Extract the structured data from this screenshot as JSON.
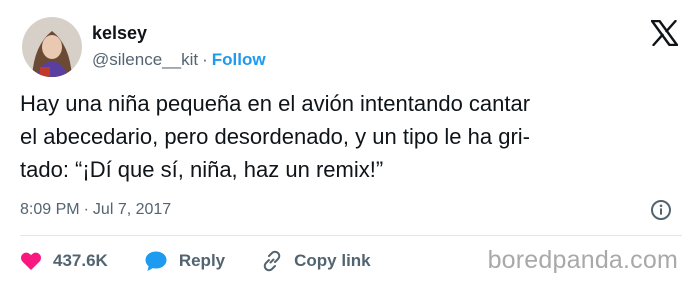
{
  "author": {
    "display_name": "kelsey",
    "handle": "@silence__kit",
    "separator": "·",
    "follow_label": "Follow"
  },
  "tweet": {
    "lines": [
      "Hay una niña pequeña en el avión intentando cantar",
      "el abecedario, pero desordenado, y un tipo le ha gri-",
      "tado: “¡Dí que sí, niña, haz un remix!”"
    ],
    "time": "8:09 PM",
    "separator": "·",
    "date": "Jul 7, 2017"
  },
  "actions": {
    "likes": "437.6K",
    "reply_label": "Reply",
    "copy_link_label": "Copy link"
  },
  "watermark": "boredpanda.com",
  "colors": {
    "text": "#0f1419",
    "secondary": "#536471",
    "accent": "#1d9bf0",
    "like": "#f91880",
    "divider": "#e1e8ed",
    "watermark": "#a9a9a9"
  },
  "icons": [
    "x-logo-icon",
    "info-icon",
    "heart-icon",
    "reply-bubble-icon",
    "link-icon"
  ]
}
